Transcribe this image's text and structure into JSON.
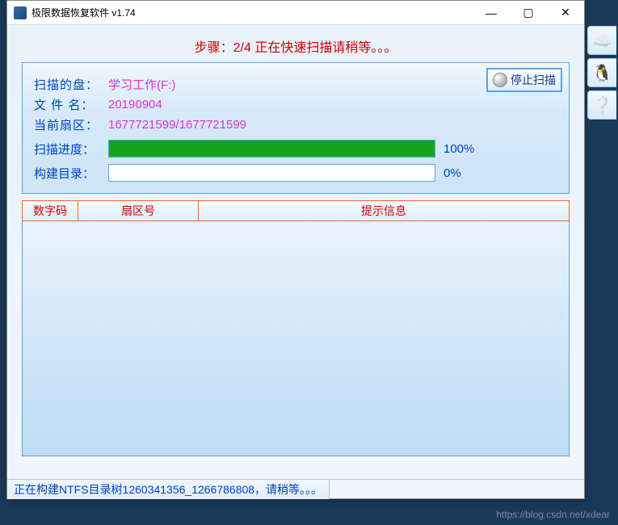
{
  "window": {
    "title": "极限数据恢复软件 v1.74"
  },
  "banner": {
    "step_text": "步骤：2/4 正在快速扫描请稍等。。。"
  },
  "actions": {
    "stop_scan_label": "停止扫描"
  },
  "scan": {
    "disk_label": "扫描的盘：",
    "disk_value": "学习工作(F:)",
    "file_label": "文 件 名：",
    "file_value": "20190904",
    "sector_label": "当前扇区：",
    "sector_value": "1677721599/1677721599",
    "progress_label": "扫描进度：",
    "progress_pct": "100%",
    "progress_fill_pct": 100,
    "build_label": "构建目录：",
    "build_pct": "0%",
    "build_fill_pct": 0
  },
  "table": {
    "columns": {
      "code": "数字码",
      "sector": "扇区号",
      "hint": "提示信息"
    },
    "rows": []
  },
  "statusbar": {
    "text": "正在构建NTFS目录树1260341356_1266786808，请稍等。。。"
  },
  "watermark": "https://blog.csdn.net/xdear"
}
